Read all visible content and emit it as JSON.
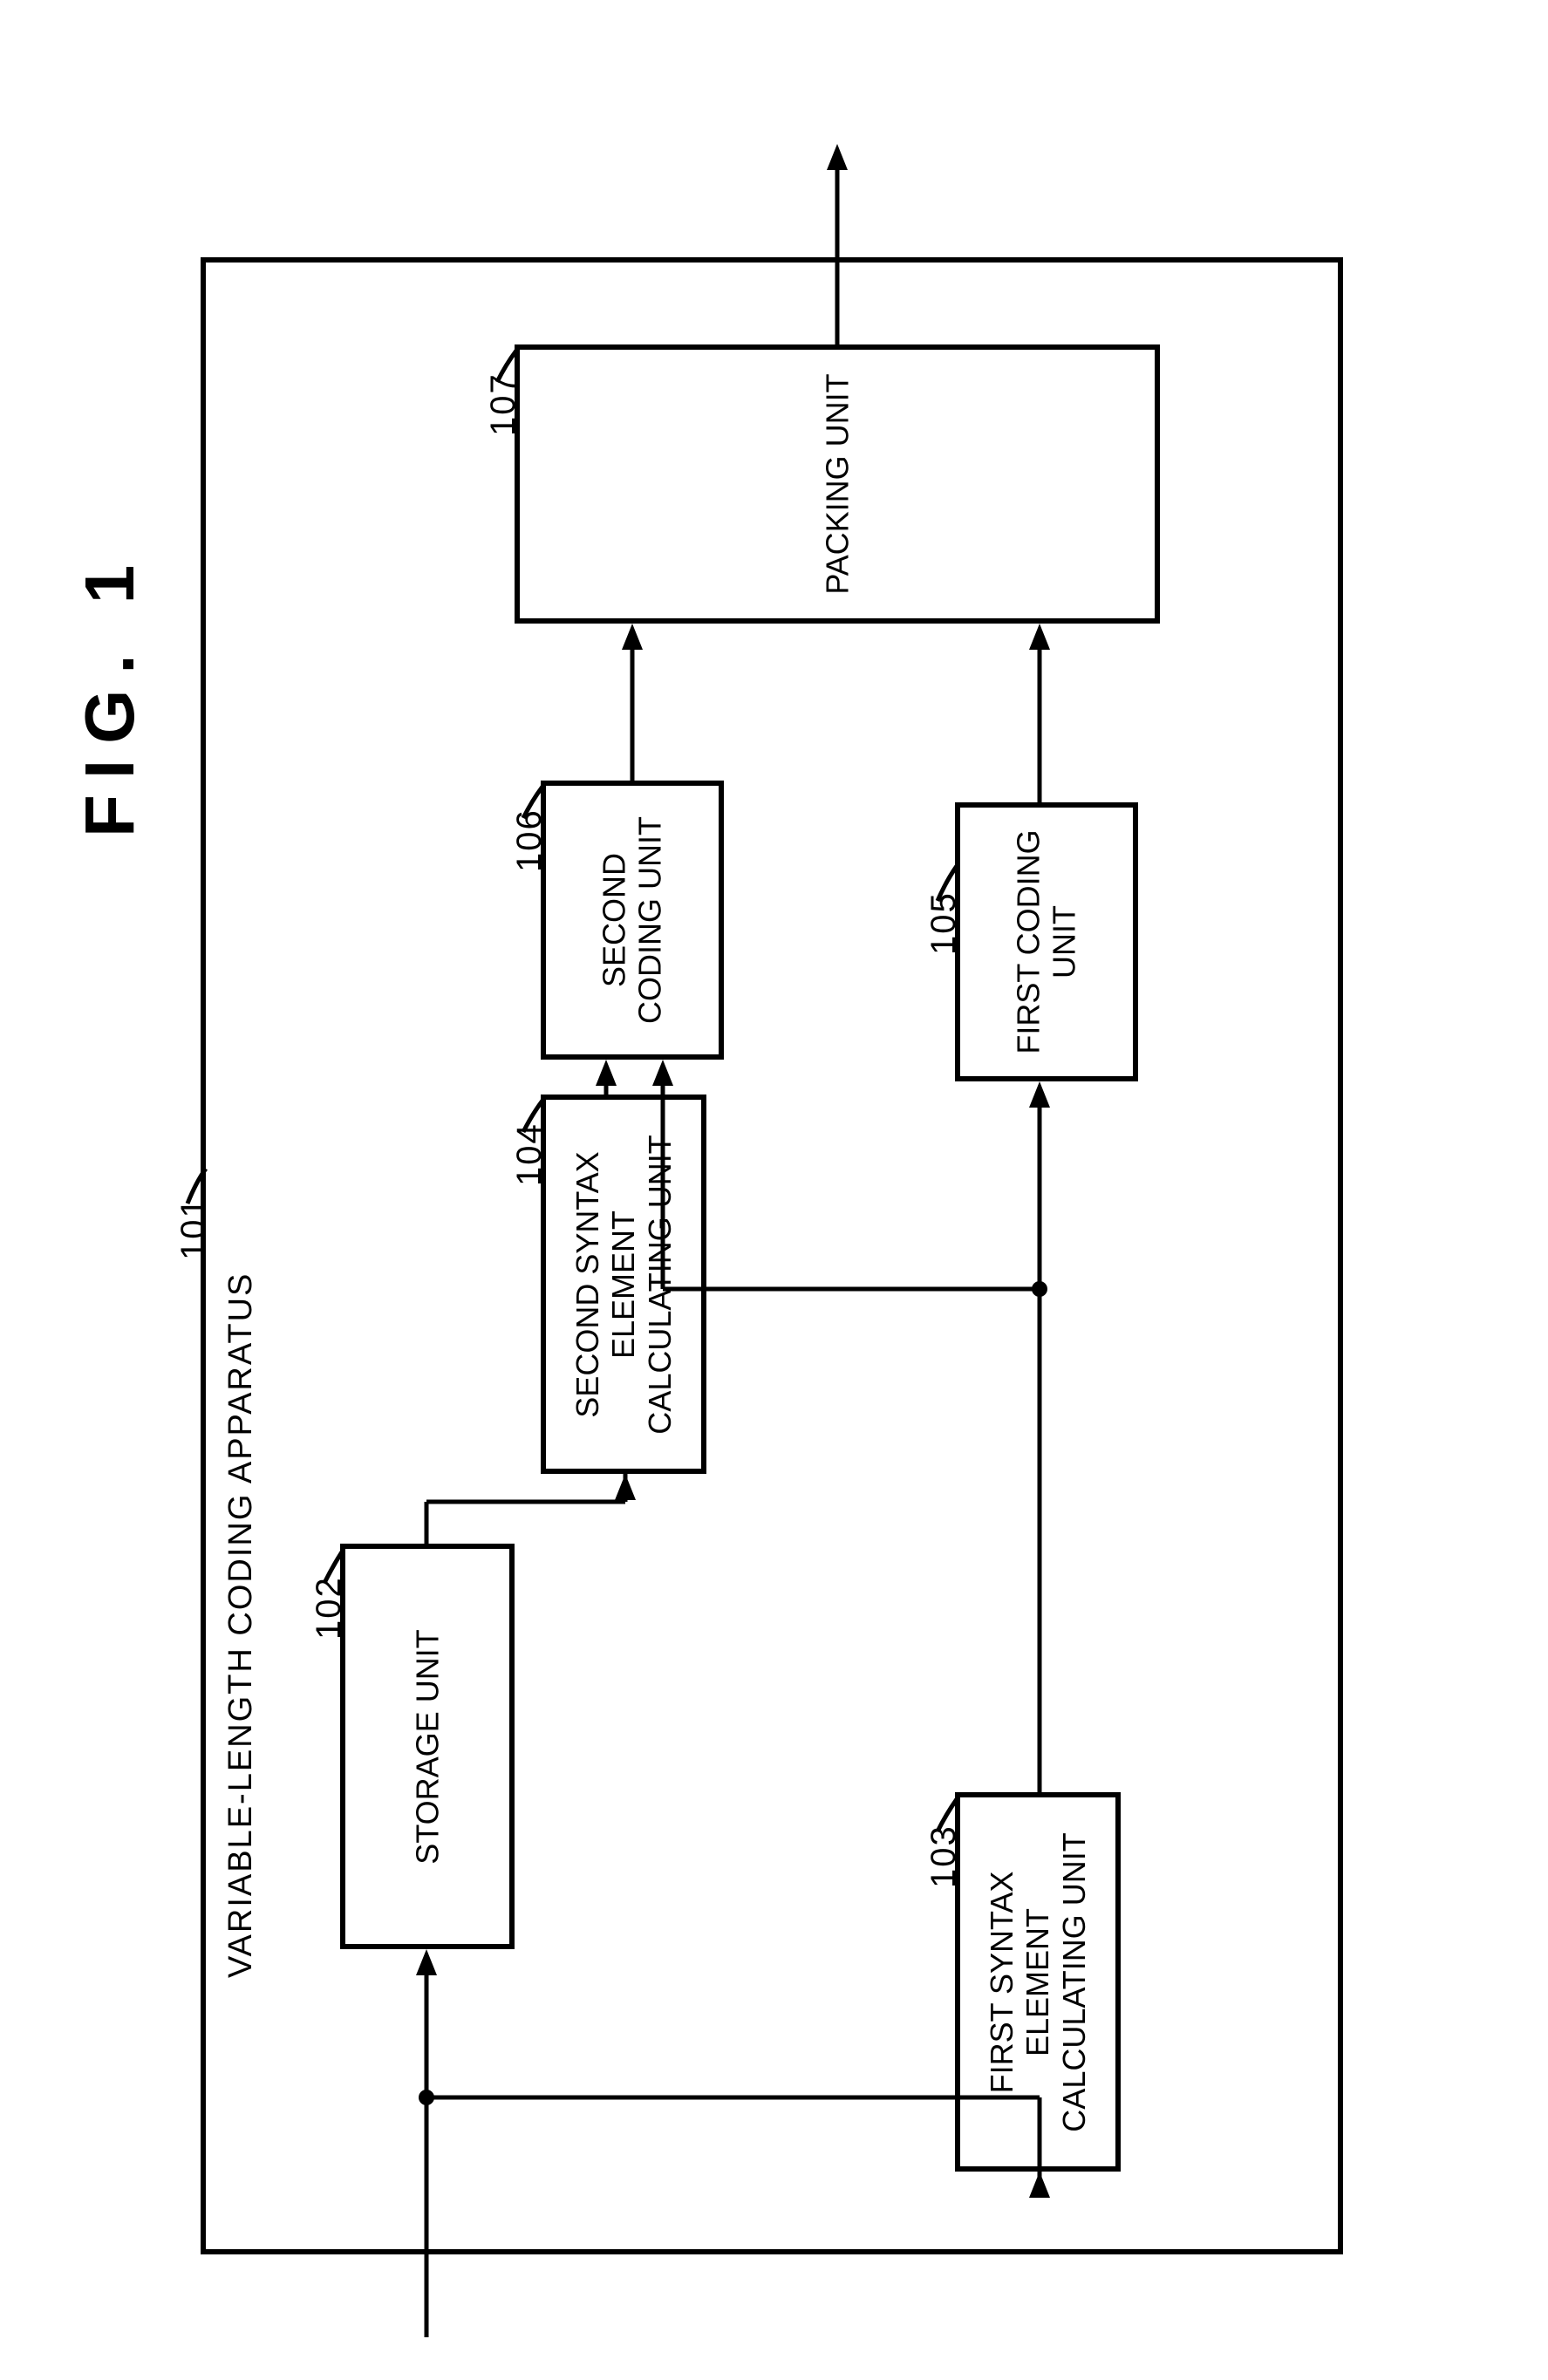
{
  "figure_title": "FIG. 1",
  "container": {
    "ref": "101",
    "label": "VARIABLE-LENGTH CODING APPARATUS"
  },
  "blocks": {
    "storage": {
      "ref": "102",
      "label": "STORAGE UNIT"
    },
    "first_calc": {
      "ref": "103",
      "label_l1": "FIRST SYNTAX",
      "label_l2": "ELEMENT",
      "label_l3": "CALCULATING UNIT"
    },
    "second_calc": {
      "ref": "104",
      "label_l1": "SECOND SYNTAX",
      "label_l2": "ELEMENT",
      "label_l3": "CALCULATING UNIT"
    },
    "first_coding": {
      "ref": "105",
      "label_l1": "FIRST CODING",
      "label_l2": "UNIT"
    },
    "second_coding": {
      "ref": "106",
      "label_l1": "SECOND",
      "label_l2": "CODING UNIT"
    },
    "packing": {
      "ref": "107",
      "label": "PACKING UNIT"
    }
  }
}
